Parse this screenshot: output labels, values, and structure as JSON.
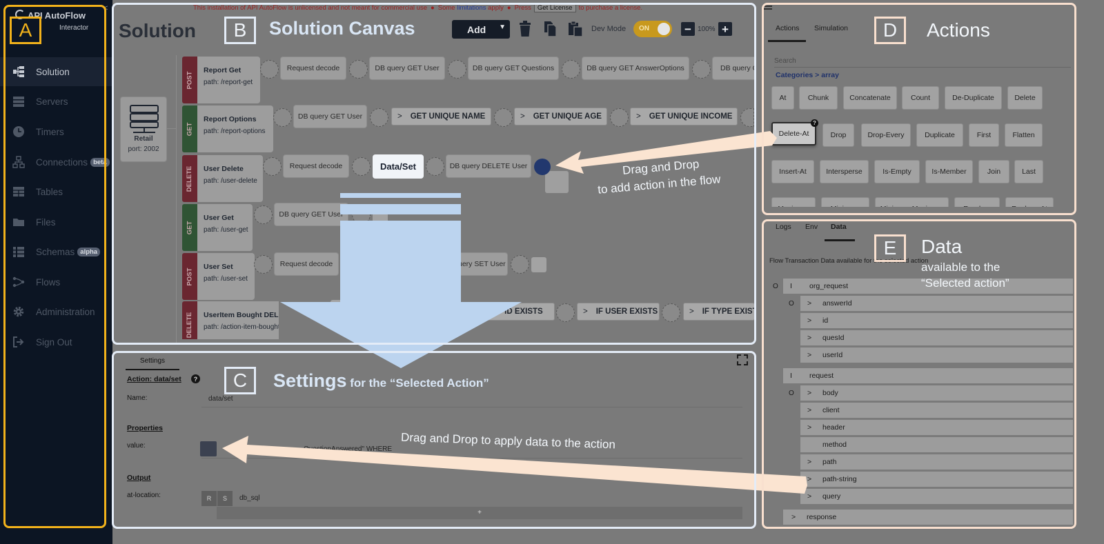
{
  "colors": {
    "frame_blue": "#e4ecf7",
    "frame_peach": "#f9e0cf",
    "frame_yellow": "#f2b21b",
    "arrow_blue": "#bcd4ef",
    "arrow_peach": "#fbe4d1",
    "sidebar_bg": "#0c1523",
    "post_red": "#6a2630",
    "get_green": "#2f5434",
    "dev_toggle": "#c8991d",
    "drop_dot": "#22386e"
  },
  "sidebar": {
    "logo_title": "API AutoFlow",
    "logo_sub": "Interactor",
    "items": [
      {
        "label": "Solution",
        "icon": "hierarchy-icon"
      },
      {
        "label": "Servers",
        "icon": "servers-icon"
      },
      {
        "label": "Timers",
        "icon": "clock-icon"
      },
      {
        "label": "Connections",
        "icon": "network-icon",
        "badge": "beta"
      },
      {
        "label": "Tables",
        "icon": "table-icon"
      },
      {
        "label": "Files",
        "icon": "folder-icon"
      },
      {
        "label": "Schemas",
        "icon": "schema-icon",
        "badge": "alpha"
      },
      {
        "label": "Flows",
        "icon": "flows-icon"
      },
      {
        "label": "Administration",
        "icon": "gear-icon"
      },
      {
        "label": "Sign Out",
        "icon": "sign-out-icon"
      }
    ]
  },
  "license_bar": {
    "text1": "This installation of API AutoFlow is unlicensed and not meant for commercial use",
    "text2": "Some",
    "link": "limitations",
    "text3": "apply",
    "text4": "Press",
    "button": "Get License",
    "text5": "to purchase a license."
  },
  "canvas": {
    "title": "Solution",
    "add_label": "Add",
    "dev_mode_label": "Dev Mode",
    "dev_mode_state": "ON",
    "zoom": "100%",
    "server": {
      "name": "Retail",
      "port": "port: 2002"
    },
    "routes": [
      {
        "method": "POST",
        "name": "Report Get",
        "path": "path: /report-get"
      },
      {
        "method": "GET",
        "name": "Report Options",
        "path": "path: /report-options"
      },
      {
        "method": "DELETE",
        "name": "User Delete",
        "path": "path: /user-delete"
      },
      {
        "method": "GET",
        "name": "User Get",
        "path": "path: /user-get"
      },
      {
        "method": "POST",
        "name": "User Set",
        "path": "path: /user-set"
      },
      {
        "method": "DELETE",
        "name": "UserItem Bought DELETE",
        "path": "path: /action-item-bought-delete"
      }
    ],
    "actions": {
      "r1": [
        "Request decode",
        "DB query GET User",
        "DB query GET Questions",
        "DB query GET AnswerOptions",
        "DB query GE"
      ],
      "r2": [
        "DB query GET User",
        "GET UNIQUE NAME",
        "GET UNIQUE AGE",
        "GET UNIQUE INCOME"
      ],
      "r3": [
        "Request decode",
        "Data/Set",
        "DB query DELETE User"
      ],
      "r4": [
        "DB query GET User"
      ],
      "r5": [
        "Request decode",
        "uery SET User"
      ],
      "r6": [
        "IF ID EXISTS",
        "IF USER EXISTS",
        "IF TYPE EXISTS"
      ]
    }
  },
  "settings": {
    "tab": "Settings",
    "action_title": "Action: data/set",
    "name_label": "Name:",
    "name_value": "data/set",
    "properties_label": "Properties",
    "value_label": "value:",
    "value_text": "QuestionAnswered\" WHERE",
    "output_label": "Output",
    "location_label": "at-location:",
    "r_label": "R",
    "s_label": "S",
    "location_value": "db_sql",
    "add_row": "+"
  },
  "actions_panel": {
    "tabs": [
      "Actions",
      "Simulation"
    ],
    "search_placeholder": "Search",
    "breadcrumb": "Categories  > array",
    "items": [
      "At",
      "Chunk",
      "Concatenate",
      "Count",
      "De-Duplicate",
      "Delete",
      "Delete-At",
      "Drop",
      "Drop-Every",
      "Duplicate",
      "First",
      "Flatten",
      "Insert-At",
      "Intersperse",
      "Is-Empty",
      "Is-Member",
      "Join",
      "Last",
      "Maximum",
      "Minimum",
      "Minimum-Maximum",
      "Random",
      "Replace-At"
    ],
    "selected": "Delete-At"
  },
  "data_panel": {
    "tabs": [
      "Logs",
      "Env",
      "Data"
    ],
    "hint": "Flow Transaction Data available for the selected action",
    "tree": [
      {
        "label": "org_request",
        "mark": "I",
        "o": "O"
      },
      {
        "label": "answerId",
        "mark": ">",
        "o": "O"
      },
      {
        "label": "id",
        "mark": ">"
      },
      {
        "label": "quesId",
        "mark": ">"
      },
      {
        "label": "userId",
        "mark": ">"
      },
      {
        "label": "request",
        "mark": "I"
      },
      {
        "label": "body",
        "mark": ">",
        "o": "O"
      },
      {
        "label": "client",
        "mark": ">"
      },
      {
        "label": "header",
        "mark": ">"
      },
      {
        "label": "method",
        "mark": ""
      },
      {
        "label": "path",
        "mark": ">"
      },
      {
        "label": "path-string",
        "mark": ">"
      },
      {
        "label": "query",
        "mark": ">"
      },
      {
        "label": "response",
        "mark": ">"
      }
    ]
  },
  "annotations": {
    "a": "A",
    "b": "B",
    "b_title": "Solution Canvas",
    "c": "C",
    "c_title": "Settings",
    "c_sub": " for the “Selected Action”",
    "d": "D",
    "d_title": "Actions",
    "e": "E",
    "e_title": "Data",
    "e_sub1": "available to the",
    "e_sub2": "“Selected action”",
    "drag1_line1": "Drag and Drop",
    "drag1_line2": "to add action in the flow",
    "drag2": "Drag and Drop to apply data to the action"
  }
}
